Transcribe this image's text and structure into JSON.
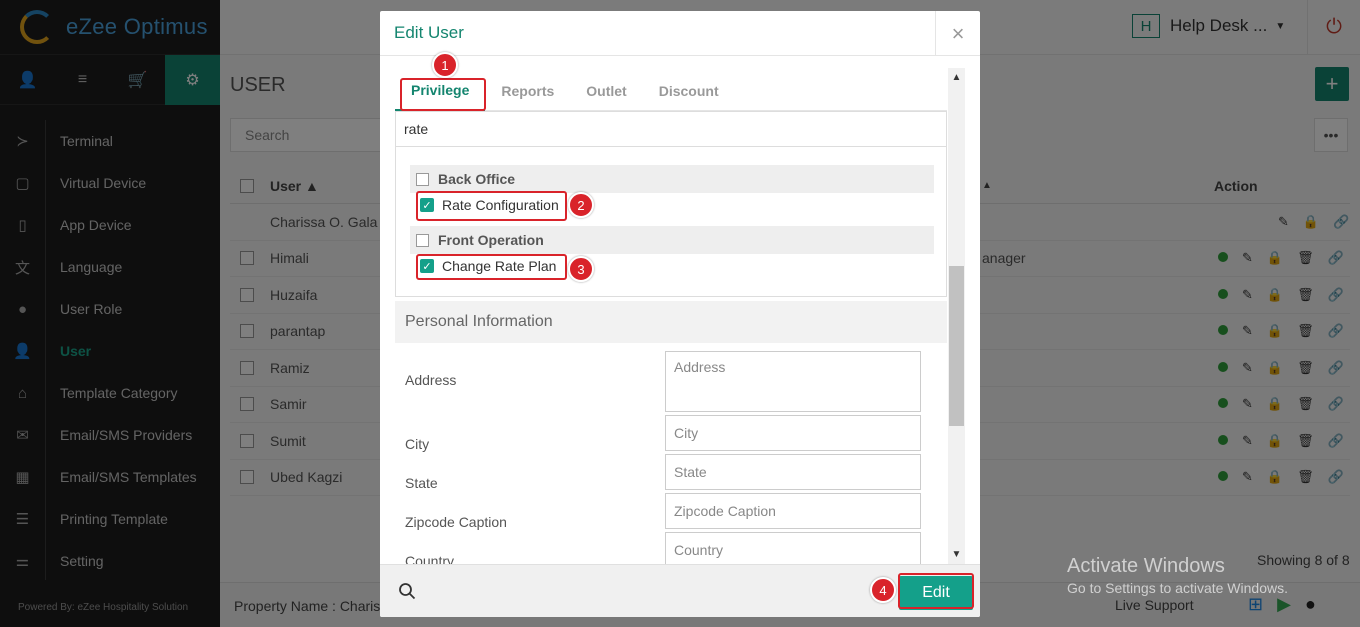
{
  "app": {
    "logo_text": "eZee Optimus",
    "powered_by": "Powered By: eZee Hospitality Solution"
  },
  "sidebar": {
    "top_tabs": [
      {
        "icon": "user-icon",
        "glyph": "👤"
      },
      {
        "icon": "list-icon",
        "glyph": "≡"
      },
      {
        "icon": "cart-icon",
        "glyph": "🛒"
      },
      {
        "icon": "gear-icon",
        "glyph": "⚙"
      }
    ],
    "items": [
      {
        "label": "Terminal",
        "icon": "terminal-icon",
        "glyph": "≻"
      },
      {
        "label": "Virtual Device",
        "icon": "tablet-icon",
        "glyph": "▢"
      },
      {
        "label": "App Device",
        "icon": "mobile-icon",
        "glyph": "▯"
      },
      {
        "label": "Language",
        "icon": "language-icon",
        "glyph": "文"
      },
      {
        "label": "User Role",
        "icon": "user-role-icon",
        "glyph": "●"
      },
      {
        "label": "User",
        "icon": "user-icon",
        "glyph": "👤"
      },
      {
        "label": "Template Category",
        "icon": "inbox-icon",
        "glyph": "⌂"
      },
      {
        "label": "Email/SMS Providers",
        "icon": "envelope-icon",
        "glyph": "✉"
      },
      {
        "label": "Email/SMS Templates",
        "icon": "calendar-icon",
        "glyph": "▦"
      },
      {
        "label": "Printing Template",
        "icon": "document-icon",
        "glyph": "☰"
      },
      {
        "label": "Setting",
        "icon": "sliders-icon",
        "glyph": "⚌"
      }
    ]
  },
  "topbar": {
    "help_badge": "H",
    "help_label": "Help Desk ...",
    "caret": "▼",
    "power_glyph": "⏻"
  },
  "page": {
    "title": "USER",
    "search_placeholder": "Search",
    "add_glyph": "+",
    "more_glyph": "•••",
    "col_user": "User ▲",
    "col_sort": "▲",
    "col_action": "Action",
    "rows": [
      {
        "name": "Charissa O. Gala",
        "role": "",
        "checkbox": false
      },
      {
        "name": "Himali",
        "role": "anager",
        "checkbox": true
      },
      {
        "name": "Huzaifa",
        "role": "",
        "checkbox": true
      },
      {
        "name": "parantap",
        "role": "",
        "checkbox": true
      },
      {
        "name": "Ramiz",
        "role": "",
        "checkbox": true
      },
      {
        "name": "Samir",
        "role": "",
        "checkbox": true
      },
      {
        "name": "Sumit",
        "role": "",
        "checkbox": true
      },
      {
        "name": "Ubed Kagzi",
        "role": "",
        "checkbox": true
      }
    ],
    "showing": "Showing 8 of 8",
    "property_name": "Property Name : Charis",
    "live_support": "Live Support",
    "watermark_title": "Activate Windows",
    "watermark_sub": "Go to Settings to activate Windows.",
    "colors": {
      "accent": "#14856f",
      "status_green": "#2e9e3a",
      "annotation_red": "#d9232a"
    }
  },
  "modal": {
    "title": "Edit User",
    "close_glyph": "×",
    "tabs": [
      "Privilege",
      "Reports",
      "Outlet",
      "Discount"
    ],
    "privilege_search_value": "rate",
    "groups": [
      {
        "name": "Back Office",
        "items": [
          "Rate Configuration"
        ]
      },
      {
        "name": "Front Operation",
        "items": [
          "Change Rate Plan"
        ]
      }
    ],
    "personal_section": "Personal Information",
    "fields": [
      {
        "label": "Address",
        "placeholder": "Address"
      },
      {
        "label": "City",
        "placeholder": "City"
      },
      {
        "label": "State",
        "placeholder": "State"
      },
      {
        "label": "Zipcode Caption",
        "placeholder": "Zipcode Caption"
      },
      {
        "label": "Country",
        "placeholder": "Country"
      }
    ],
    "edit_label": "Edit",
    "scroll_up": "▲",
    "scroll_down": "▼"
  },
  "annotations": [
    "1",
    "2",
    "3",
    "4"
  ]
}
